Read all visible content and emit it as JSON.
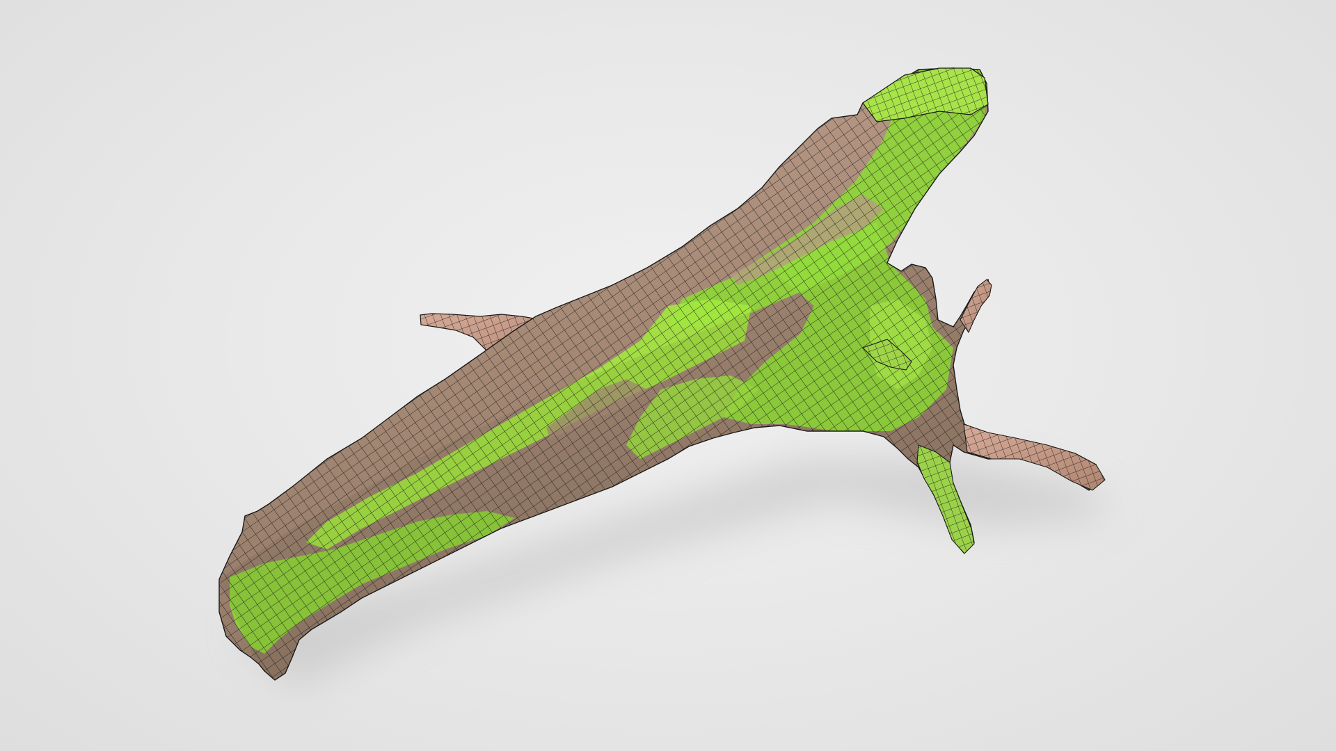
{
  "scene": {
    "subject": "mossy-branch-model",
    "view_mode": "textured-wireframe",
    "colors": {
      "background": "#e8e8e8",
      "bark": "#a48a75",
      "bark_light": "#c9a898",
      "bark_pink": "#cf9c8a",
      "moss": "#8fd63a",
      "moss_bright": "#b6ef48",
      "wire": "#1a1a1a",
      "shadow": "#c9c9c9"
    }
  }
}
